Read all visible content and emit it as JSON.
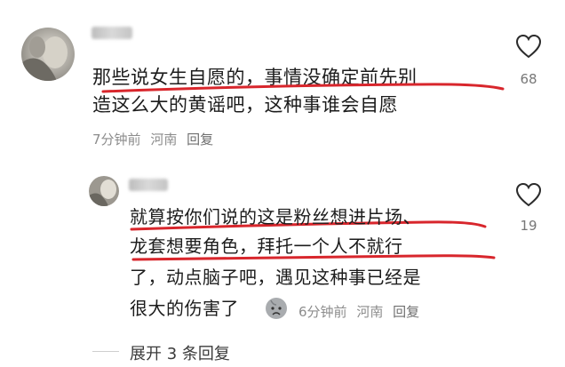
{
  "comment": {
    "lines": [
      "那些说女生自愿的，事情没确定前先别",
      "造这么大的黄谣吧，这种事谁会自愿"
    ],
    "time": "7分钟前",
    "location": "河南",
    "reply_label": "回复",
    "likes": "68"
  },
  "reply": {
    "lines": [
      "就算按你们说的这是粉丝想进片场、",
      "龙套想要角色，拜托一个人不就行",
      "了，动点脑子吧，遇见这种事已经是",
      "很大的伤害了"
    ],
    "time": "6分钟前",
    "location": "河南",
    "reply_label": "回复",
    "likes": "19",
    "emoji": "sad-face-emoji"
  },
  "expand_label": "展开 3 条回复",
  "colors": {
    "annotation_red": "#d8262c",
    "meta_gray": "#8c8c8c",
    "text": "#1c1c1c"
  },
  "icons": [
    "heart-outline-icon",
    "avatar-image"
  ]
}
